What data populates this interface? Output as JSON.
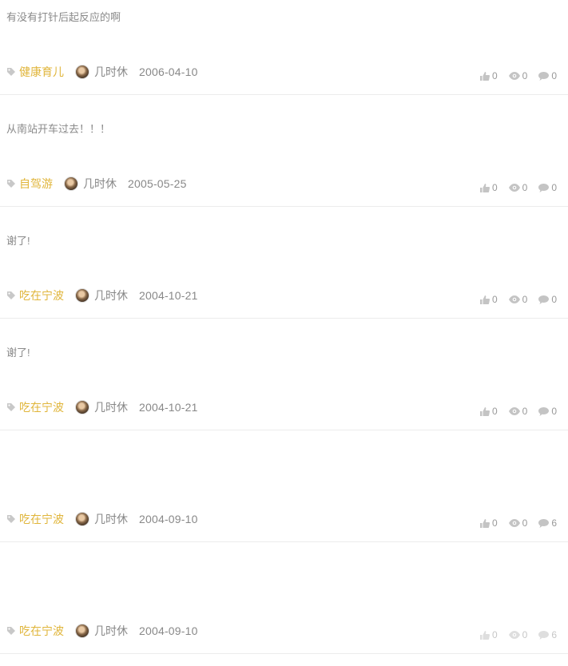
{
  "posts": [
    {
      "excerpt": "有没有打针后起反应的啊",
      "tag": "健康育儿",
      "author": "几时休",
      "date": "2006-04-10",
      "likes": "0",
      "views": "0",
      "comments": "0"
    },
    {
      "excerpt": "从南站开车过去！！！",
      "tag": "自驾游",
      "author": "几时休",
      "date": "2005-05-25",
      "likes": "0",
      "views": "0",
      "comments": "0"
    },
    {
      "excerpt": "谢了!",
      "tag": "吃在宁波",
      "author": "几时休",
      "date": "2004-10-21",
      "likes": "0",
      "views": "0",
      "comments": "0"
    },
    {
      "excerpt": "谢了!",
      "tag": "吃在宁波",
      "author": "几时休",
      "date": "2004-10-21",
      "likes": "0",
      "views": "0",
      "comments": "0"
    },
    {
      "excerpt": "",
      "tag": "吃在宁波",
      "author": "几时休",
      "date": "2004-09-10",
      "likes": "0",
      "views": "0",
      "comments": "6"
    },
    {
      "excerpt": "",
      "tag": "吃在宁波",
      "author": "几时休",
      "date": "2004-09-10",
      "likes": "0",
      "views": "0",
      "comments": "6"
    }
  ],
  "icons": {
    "tag": "tag-icon",
    "like": "thumbs-up-icon",
    "view": "eye-icon",
    "comment": "comment-icon"
  },
  "colors": {
    "tag": "#e0b53a",
    "text": "#888888",
    "divider": "#ececec"
  }
}
